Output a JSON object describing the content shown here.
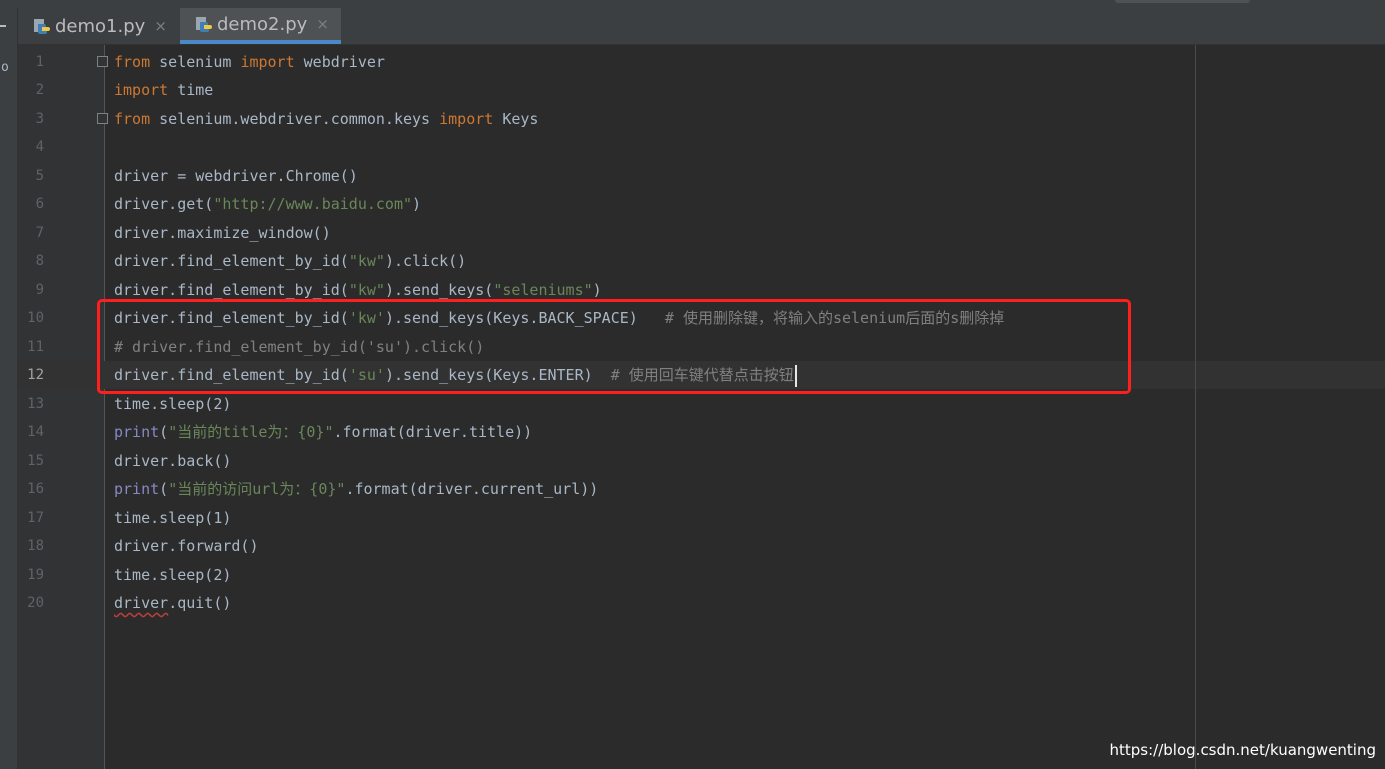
{
  "tabs": [
    {
      "label": "demo1.py",
      "close": "×",
      "icon": "python-file-icon",
      "active": false
    },
    {
      "label": "demo2.py",
      "close": "×",
      "icon": "python-file-icon",
      "active": true
    }
  ],
  "side_panel": {
    "fragment": "o"
  },
  "line_numbers": [
    "1",
    "2",
    "3",
    "4",
    "5",
    "6",
    "7",
    "8",
    "9",
    "10",
    "11",
    "12",
    "13",
    "14",
    "15",
    "16",
    "17",
    "18",
    "19",
    "20"
  ],
  "code": {
    "l1": [
      "from",
      " selenium ",
      "import",
      " webdriver"
    ],
    "l2": [
      "import",
      " time"
    ],
    "l3": [
      "from",
      " selenium.webdriver.common.keys ",
      "import",
      " Keys"
    ],
    "l5": "driver = webdriver.Chrome()",
    "l6": [
      "driver.get(",
      "\"http://www.baidu.com\"",
      ")"
    ],
    "l7": "driver.maximize_window()",
    "l8": [
      "driver.find_element_by_id(",
      "\"kw\"",
      ").click()"
    ],
    "l9": [
      "driver.find_element_by_id(",
      "\"kw\"",
      ").send_keys(",
      "\"seleniums\"",
      ")"
    ],
    "l10": [
      "driver.find_element_by_id(",
      "'kw'",
      ").send_keys(Keys.BACK_SPACE)   ",
      "# 使用删除键，将输入的selenium后面的s删除掉"
    ],
    "l11": "# driver.find_element_by_id('su').click()",
    "l12": [
      "driver.find_element_by_id(",
      "'su'",
      ").send_keys(Keys.ENTER)  ",
      "# 使用回车键代替点击按钮"
    ],
    "l13": "time.sleep(2)",
    "l14": [
      "print",
      "(",
      "\"当前的title为：{0}\"",
      ".format(driver.title))"
    ],
    "l15": "driver.back()",
    "l16": [
      "print",
      "(",
      "\"当前的访问url为：{0}\"",
      ".format(driver.current_url))"
    ],
    "l17": "time.sleep(1)",
    "l18": "driver.forward()",
    "l19": "time.sleep(2)",
    "l20": [
      "driver",
      ".quit()"
    ]
  },
  "watermark": "https://blog.csdn.net/kuangwenting",
  "colors": {
    "background": "#2b2b2b",
    "keyword": "#cc7832",
    "string": "#6a8759",
    "comment": "#808080",
    "builtin": "#8888c6",
    "highlight_box": "#ff1f1f",
    "active_tab_underline": "#4a88c7"
  }
}
